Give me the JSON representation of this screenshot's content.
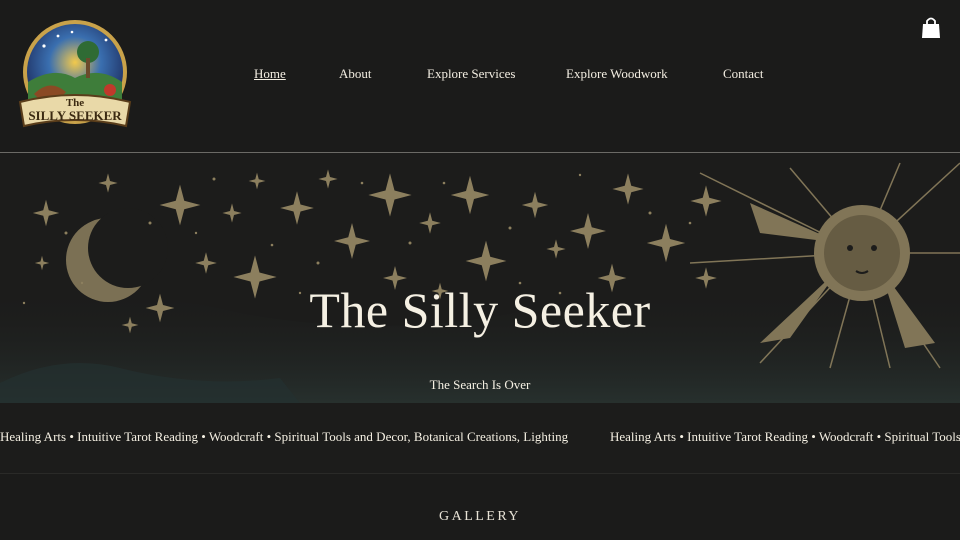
{
  "header": {
    "logo_text_line1": "The",
    "logo_text_line2": "SILLY SEEKER",
    "nav": [
      {
        "label": "Home",
        "active": true
      },
      {
        "label": "About"
      },
      {
        "label": "Explore Services"
      },
      {
        "label": "Explore Woodwork"
      },
      {
        "label": "Contact"
      }
    ],
    "cart_icon": "shopping-bag-icon"
  },
  "hero": {
    "title": "The Silly Seeker",
    "subtitle": "The Search Is Over",
    "ticker_text": "Healing Arts  • Intuitive Tarot Reading • Woodcraft • Spiritual Tools and Decor, Botanical Creations, Lighting",
    "icons": [
      "crescent-moon-icon",
      "sun-face-icon",
      "star-icon"
    ],
    "colors": {
      "background": "#1c1c1b",
      "engraving": "#8c7f5e",
      "text": "#f5f0e3"
    }
  },
  "gallery": {
    "heading": "GALLERY"
  }
}
